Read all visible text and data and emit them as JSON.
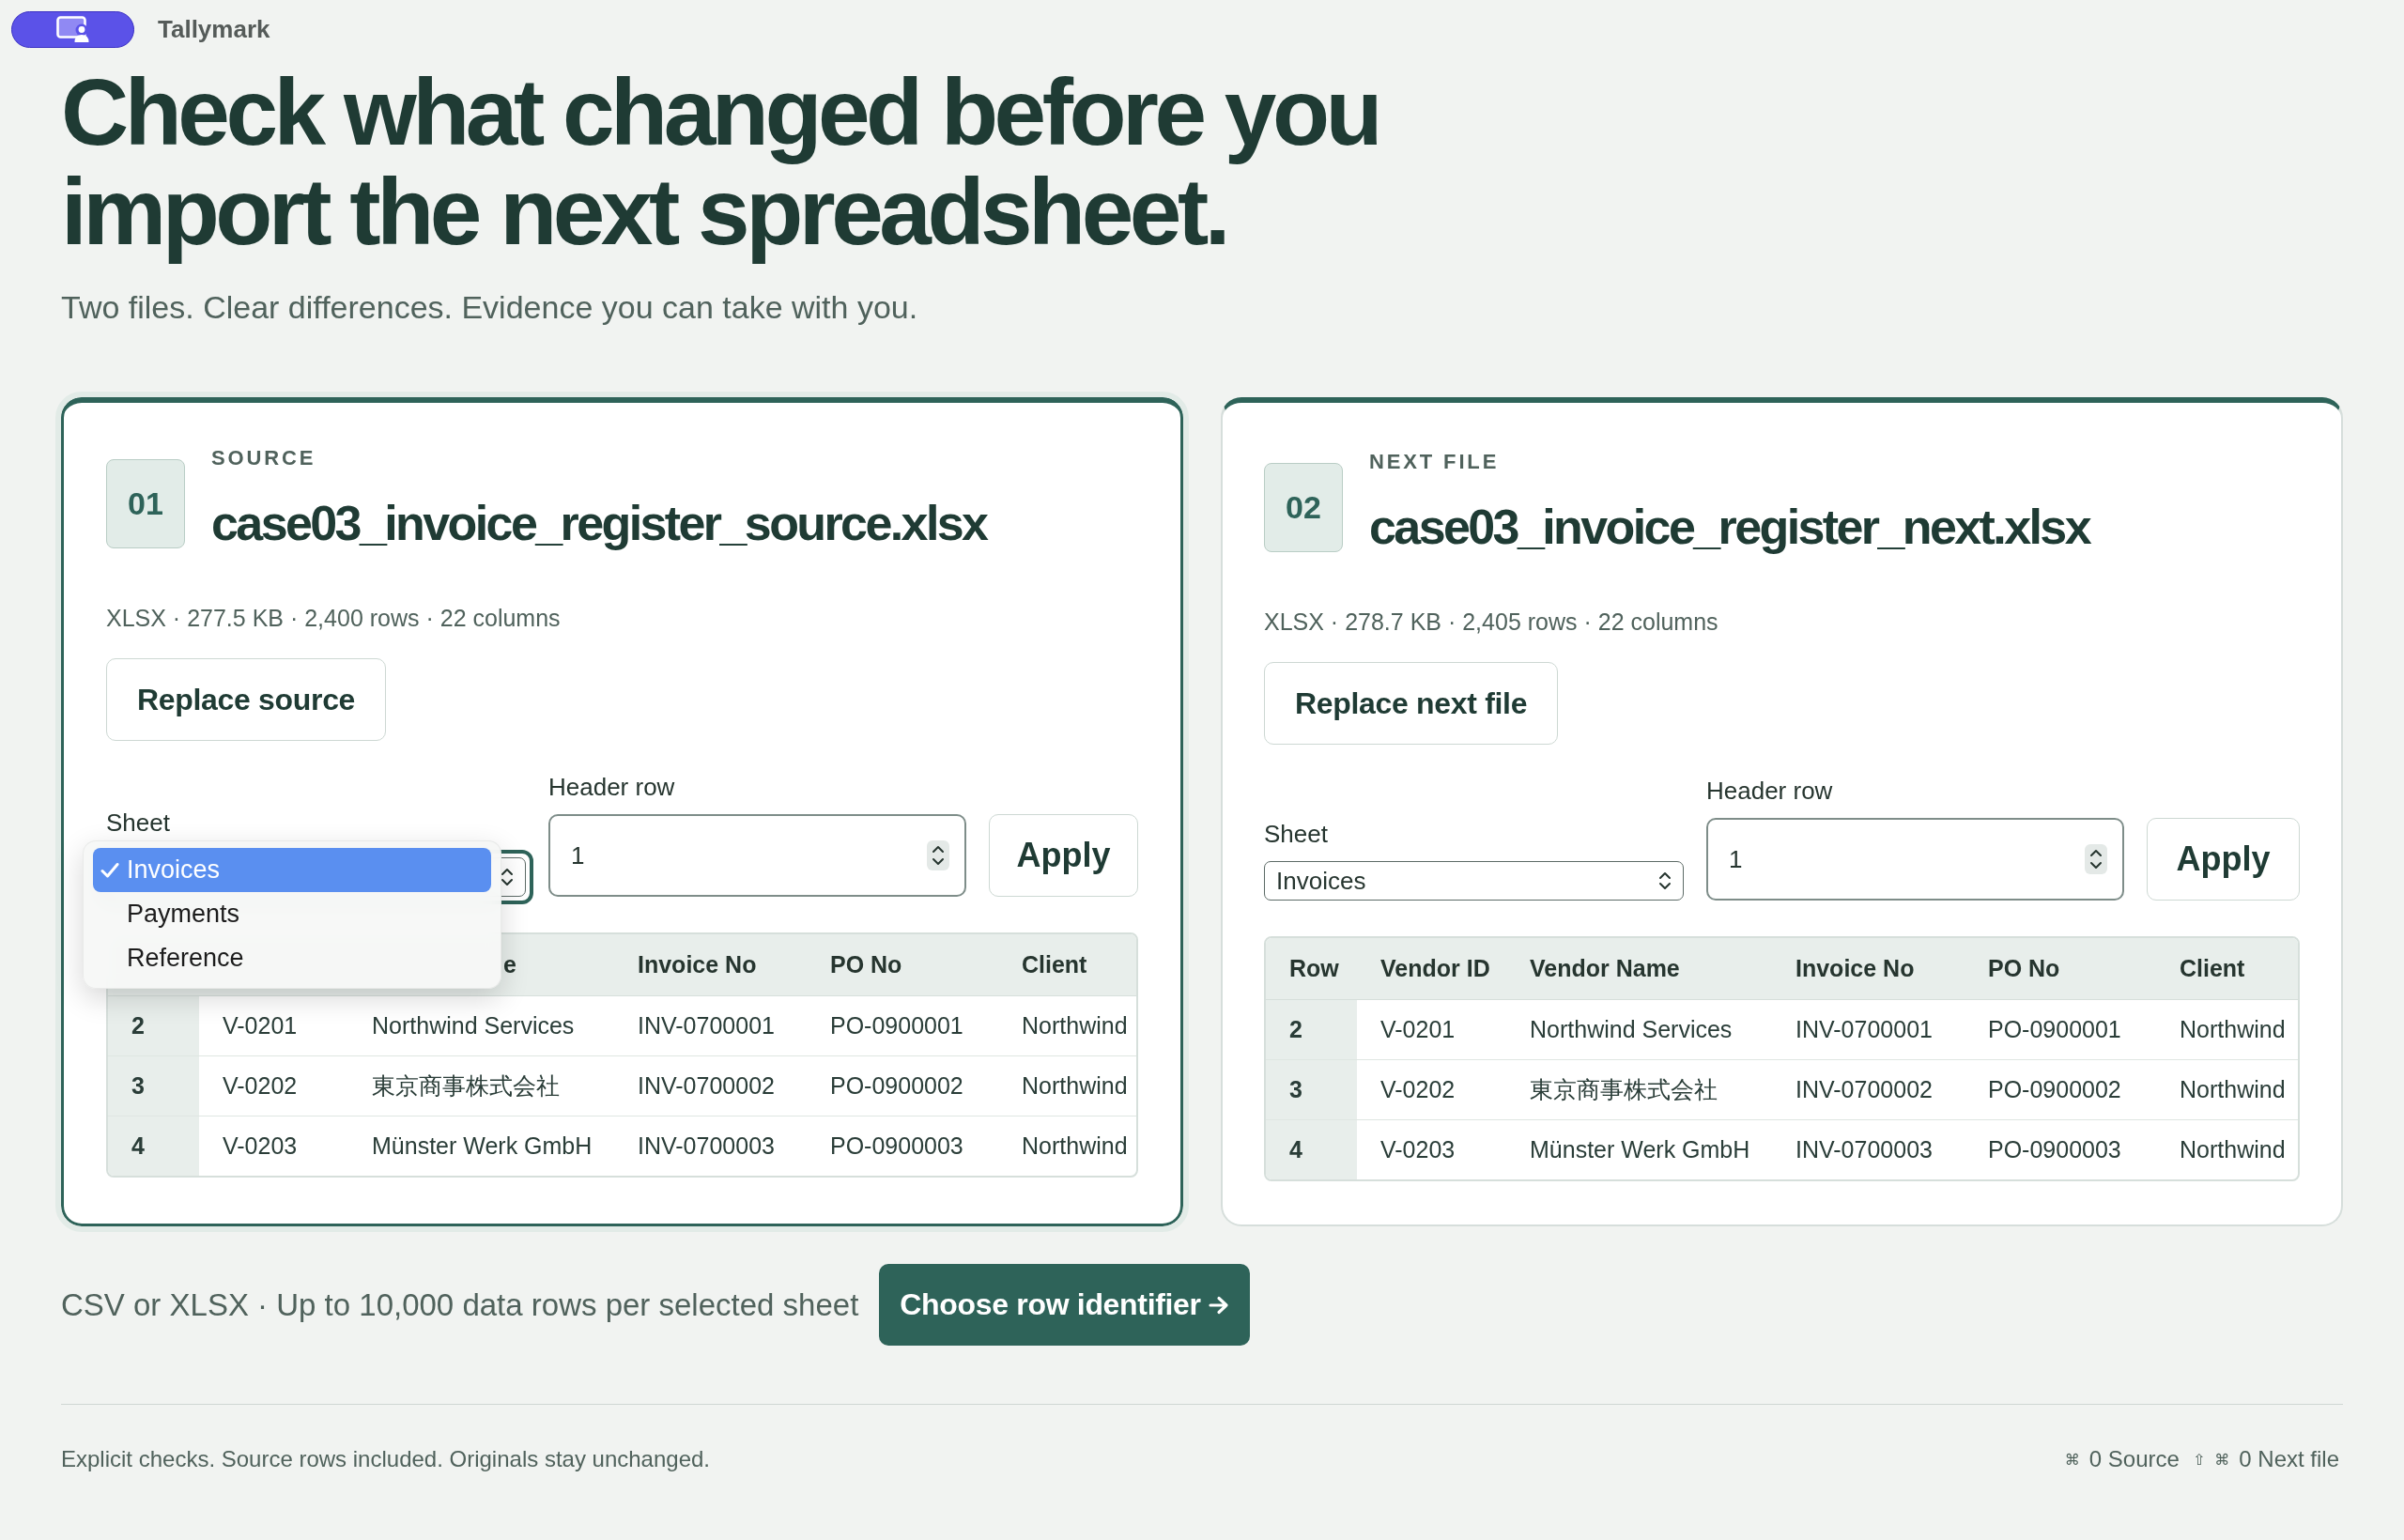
{
  "top_bar": {
    "app_name": "Tallymark"
  },
  "hero": {
    "title": "Check what changed before you import the next spreadsheet.",
    "subtitle": "Two files. Clear differences. Evidence you can take with you."
  },
  "files": [
    {
      "badge": "01",
      "kicker": "SOURCE",
      "filename": "case03_invoice_register_source.xlsx",
      "meta": "XLSX · 277.5 KB · 2,400 rows · 22 columns",
      "replace_button": "Replace source",
      "active": true,
      "sheet": {
        "label": "Sheet",
        "open": true,
        "options": [
          {
            "label": "Invoices",
            "selected": true
          },
          {
            "label": "Payments",
            "selected": false
          },
          {
            "label": "Reference",
            "selected": false
          }
        ]
      },
      "header_row": {
        "label": "Header row",
        "value": "1"
      },
      "apply_button": "Apply",
      "table": {
        "columns": [
          "",
          "",
          "e",
          "Invoice No",
          "PO No",
          "Client"
        ],
        "rows": [
          [
            "2",
            "V-0201",
            "Northwind Services",
            "INV-0700001",
            "PO-0900001",
            "Northwind"
          ],
          [
            "3",
            "V-0202",
            "東京商事株式会社",
            "INV-0700002",
            "PO-0900002",
            "Northwind"
          ],
          [
            "4",
            "V-0203",
            "Münster Werk GmbH",
            "INV-0700003",
            "PO-0900003",
            "Northwind"
          ]
        ]
      }
    },
    {
      "badge": "02",
      "kicker": "NEXT FILE",
      "filename": "case03_invoice_register_next.xlsx",
      "meta": "XLSX · 278.7 KB · 2,405 rows · 22 columns",
      "replace_button": "Replace next file",
      "active": false,
      "sheet": {
        "label": "Sheet",
        "open": false,
        "value": "Invoices"
      },
      "header_row": {
        "label": "Header row",
        "value": "1"
      },
      "apply_button": "Apply",
      "table": {
        "columns": [
          "Row",
          "Vendor ID",
          "Vendor Name",
          "Invoice No",
          "PO No",
          "Client"
        ],
        "rows": [
          [
            "2",
            "V-0201",
            "Northwind Services",
            "INV-0700001",
            "PO-0900001",
            "Northwind"
          ],
          [
            "3",
            "V-0202",
            "東京商事株式会社",
            "INV-0700002",
            "PO-0900002",
            "Northwind"
          ],
          [
            "4",
            "V-0203",
            "Münster Werk GmbH",
            "INV-0700003",
            "PO-0900003",
            "Northwind"
          ]
        ]
      }
    }
  ],
  "bottom": {
    "note": "CSV or XLSX · Up to 10,000 data rows per selected sheet",
    "button": "Choose row identifier"
  },
  "footer": {
    "note": "Explicit checks. Source rows included. Originals stay unchanged.",
    "shortcuts": [
      {
        "kind": "key",
        "text": "⌘"
      },
      {
        "kind": "label",
        "text": "0 Source"
      },
      {
        "kind": "key",
        "text": "⇧"
      },
      {
        "kind": "key",
        "text": "⌘"
      },
      {
        "kind": "label",
        "text": "0 Next file"
      }
    ]
  }
}
